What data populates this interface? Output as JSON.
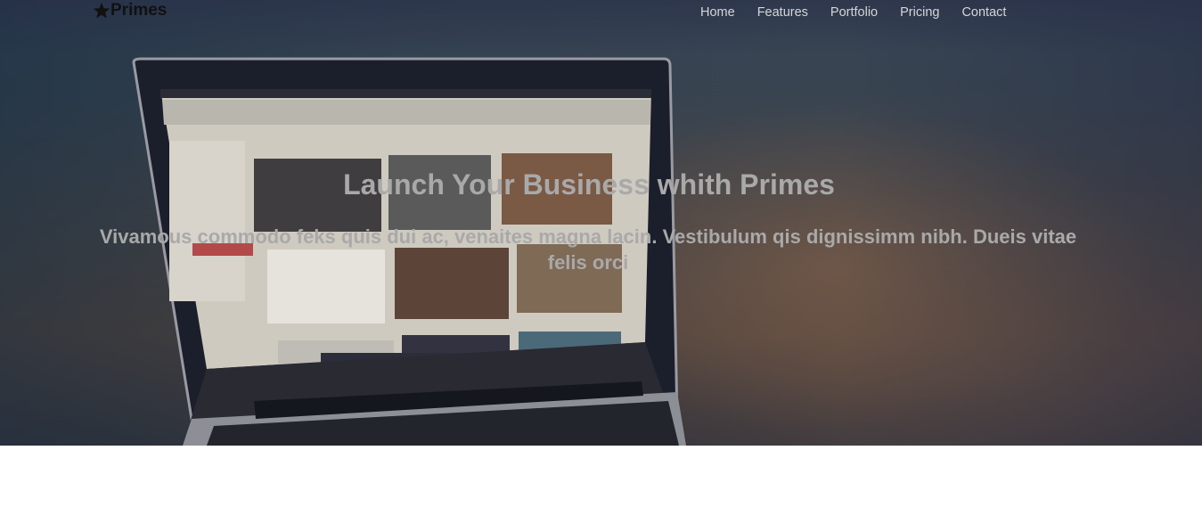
{
  "brand": {
    "name": "Primes",
    "icon": "star-icon"
  },
  "nav": {
    "items": [
      {
        "label": "Home"
      },
      {
        "label": "Features"
      },
      {
        "label": "Portfolio"
      },
      {
        "label": "Pricing"
      },
      {
        "label": "Contact"
      }
    ]
  },
  "hero": {
    "title": "Launch Your Business whith Primes",
    "subtitle": "Vivamous commodo feks quis dui ac, venaites magna lacin. Vestibulum qis dignissimm nibh. Dueis vitae felis orci"
  },
  "colors": {
    "nav_text": "#d6d6d6",
    "hero_text": "#a9a9a9",
    "brand_text": "#111111"
  }
}
